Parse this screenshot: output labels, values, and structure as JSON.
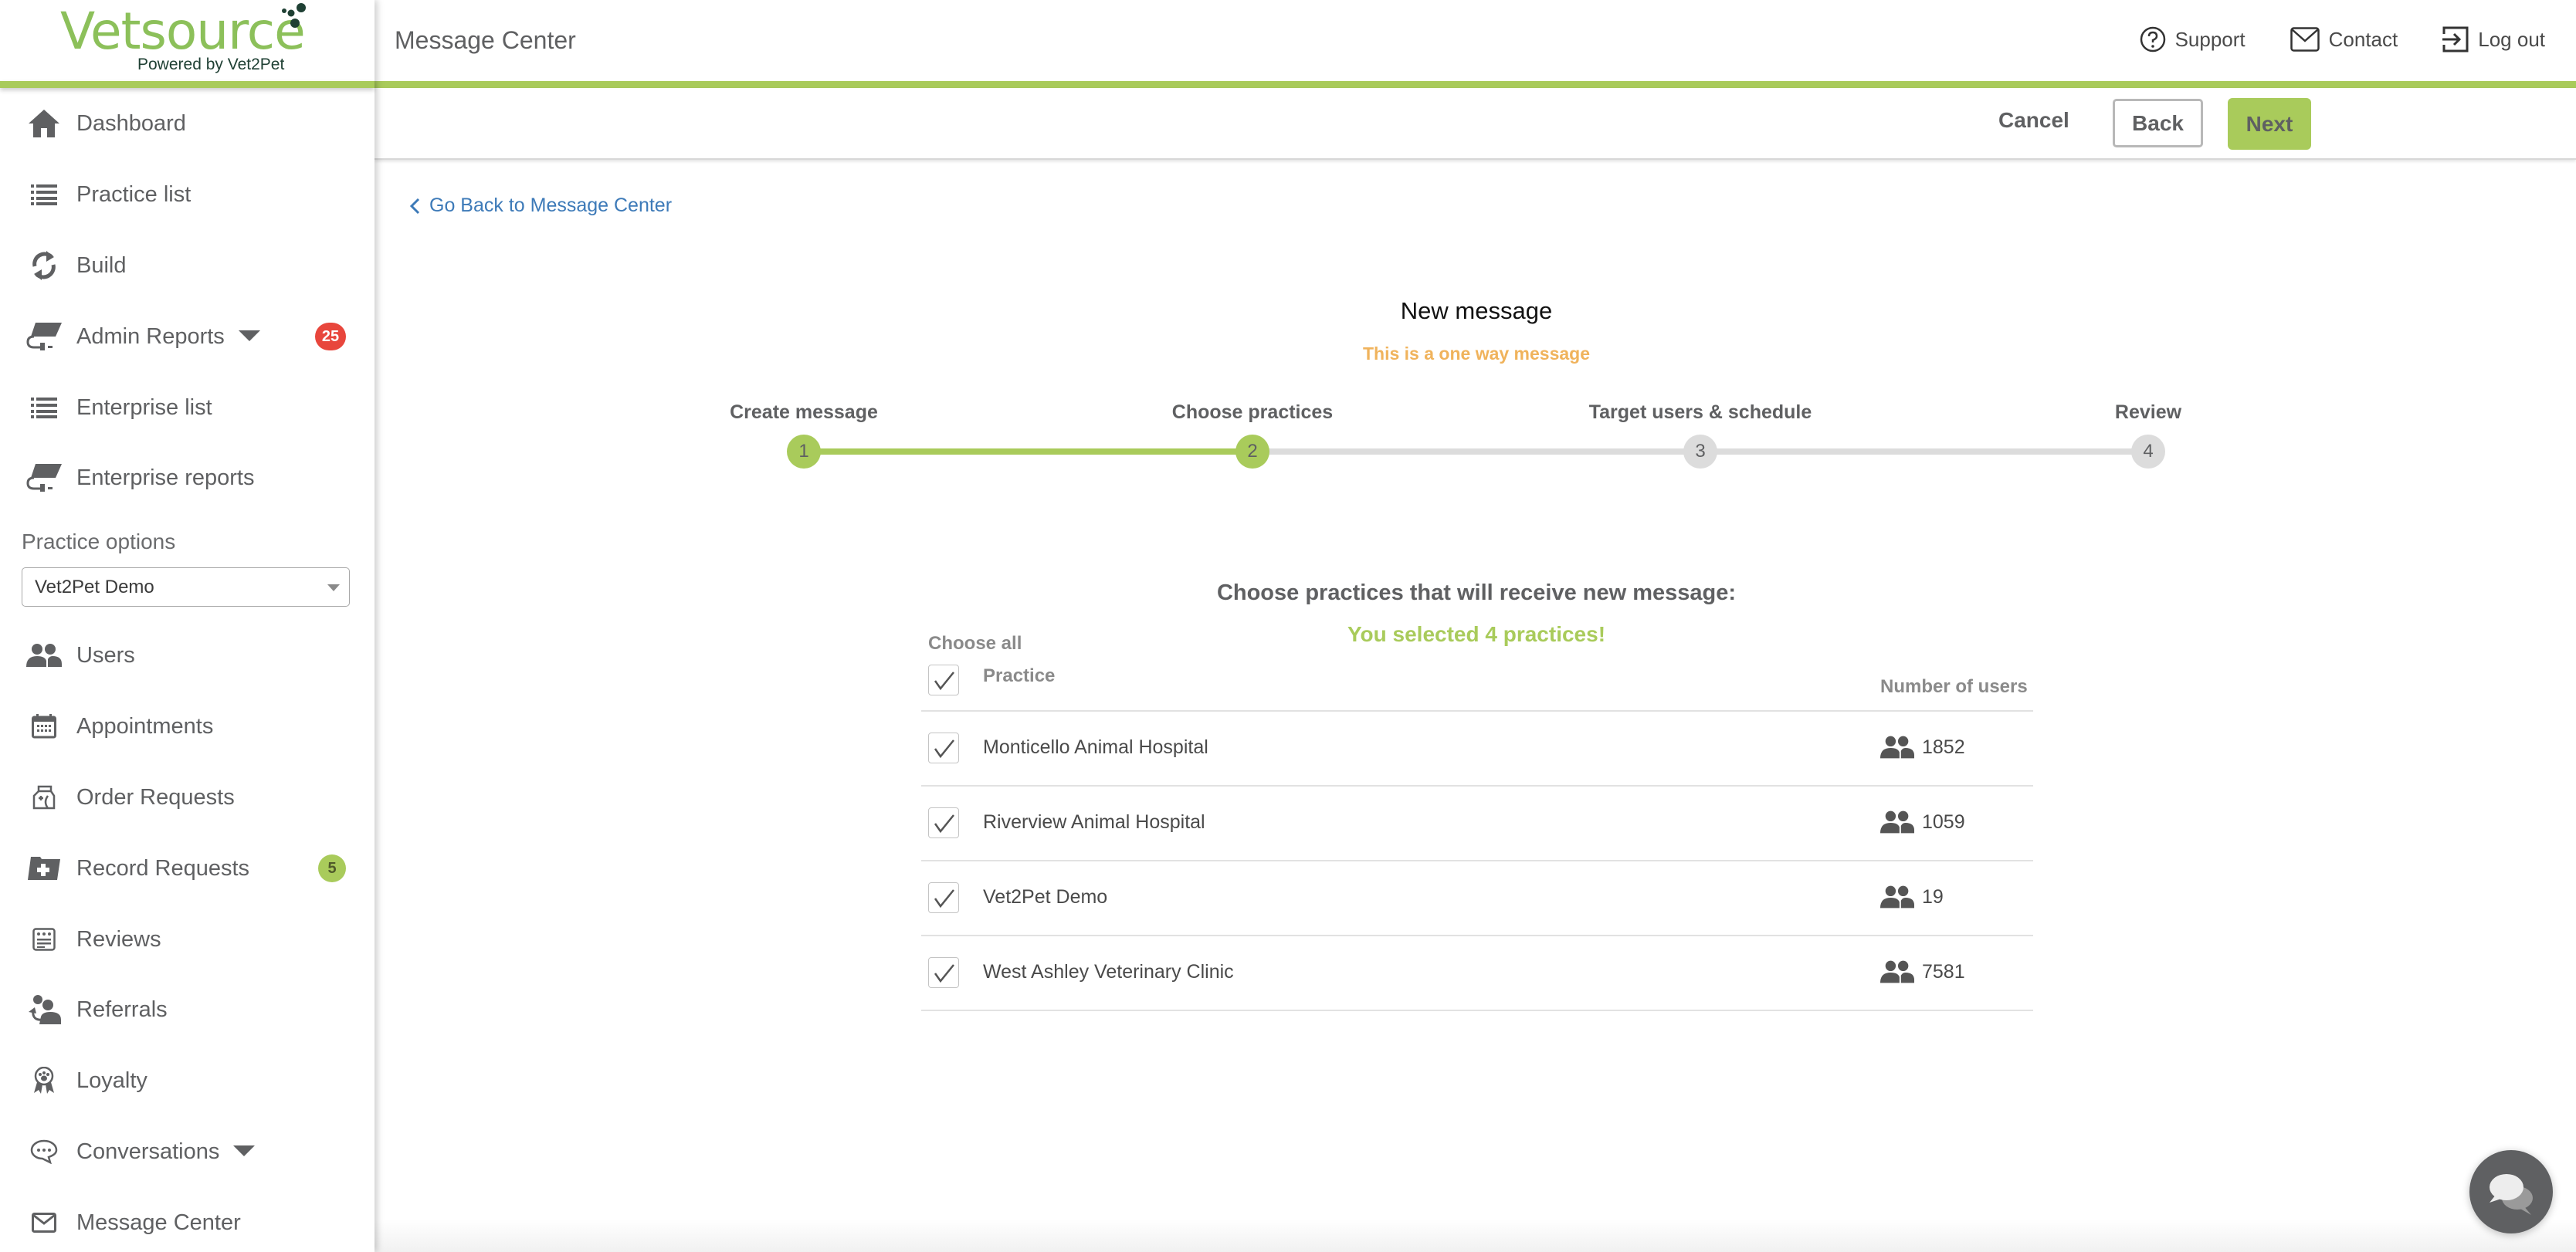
{
  "logo": {
    "brand": "Vetsource",
    "tagline": "Powered by Vet2Pet"
  },
  "header": {
    "title": "Message Center",
    "links": [
      {
        "label": "Support",
        "icon": "help-circle-icon"
      },
      {
        "label": "Contact",
        "icon": "envelope-icon"
      },
      {
        "label": "Log out",
        "icon": "logout-icon"
      }
    ]
  },
  "toolbar": {
    "cancel_label": "Cancel",
    "back_label": "Back",
    "next_label": "Next"
  },
  "sidebar": {
    "items": [
      {
        "label": "Dashboard",
        "icon": "home-icon"
      },
      {
        "label": "Practice list",
        "icon": "list-icon"
      },
      {
        "label": "Build",
        "icon": "refresh-icon"
      },
      {
        "label": "Admin Reports",
        "icon": "reports-book-icon",
        "badge": "25",
        "has_caret": true
      },
      {
        "label": "Enterprise list",
        "icon": "list-icon"
      },
      {
        "label": "Enterprise reports",
        "icon": "reports-book-icon"
      }
    ],
    "practice_options_label": "Practice options",
    "practice_select_value": "Vet2Pet Demo",
    "practice_items": [
      {
        "label": "Users",
        "icon": "users-icon"
      },
      {
        "label": "Appointments",
        "icon": "calendar-icon"
      },
      {
        "label": "Order Requests",
        "icon": "medicine-bag-icon"
      },
      {
        "label": "Record Requests",
        "icon": "medical-folder-icon",
        "badge": "5"
      },
      {
        "label": "Reviews",
        "icon": "reviews-icon"
      },
      {
        "label": "Referrals",
        "icon": "referrals-icon"
      },
      {
        "label": "Loyalty",
        "icon": "paw-ribbon-icon"
      },
      {
        "label": "Conversations",
        "icon": "chat-bubble-icon",
        "has_caret": true
      },
      {
        "label": "Message Center",
        "icon": "envelope-icon"
      }
    ]
  },
  "main": {
    "back_link": "Go Back to Message Center",
    "title": "New message",
    "subtitle": "This is a one way message",
    "steps": [
      {
        "label": "Create message",
        "number": "1",
        "status": "done"
      },
      {
        "label": "Choose practices",
        "number": "2",
        "status": "current"
      },
      {
        "label": "Target users & schedule",
        "number": "3",
        "status": "todo"
      },
      {
        "label": "Review",
        "number": "4",
        "status": "todo"
      }
    ],
    "choose_heading": "Choose practices that will receive new message:",
    "selected_message": "You selected 4 practices!",
    "choose_all_label": "Choose all",
    "choose_all_checked": true,
    "columns": {
      "practice": "Practice",
      "users": "Number of users"
    },
    "practices": [
      {
        "name": "Monticello Animal Hospital",
        "users": "1852",
        "checked": true
      },
      {
        "name": "Riverview Animal Hospital",
        "users": "1059",
        "checked": true
      },
      {
        "name": "Vet2Pet Demo",
        "users": "19",
        "checked": true
      },
      {
        "name": "West Ashley Veterinary Clinic",
        "users": "7581",
        "checked": true
      }
    ]
  },
  "colors": {
    "brand_green": "#a9cb5b",
    "warning_orange": "#f0b35c",
    "link_blue": "#3d7ab8",
    "badge_red": "#e8463c"
  }
}
